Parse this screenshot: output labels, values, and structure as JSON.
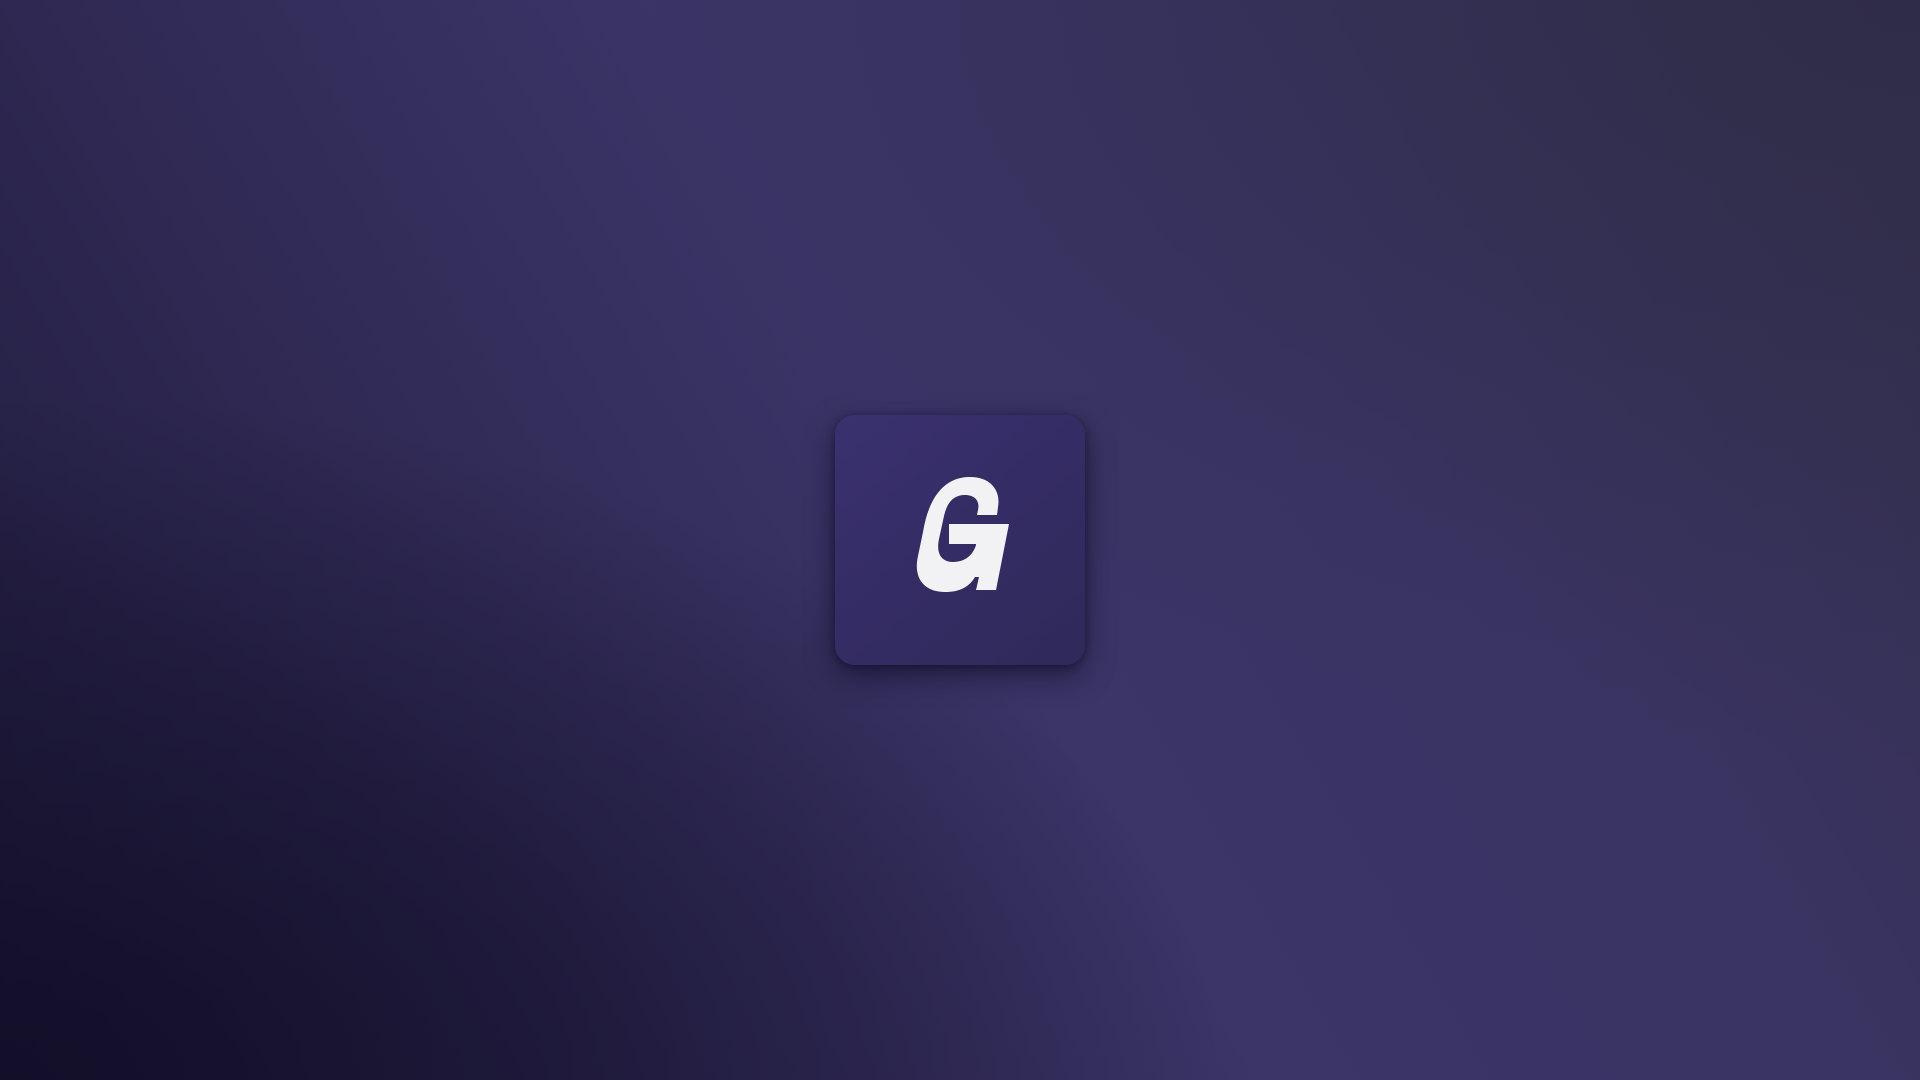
{
  "splash": {
    "logo_letter": "G",
    "icon_name": "app-logo-g-icon"
  },
  "colors": {
    "background_start": "#1e1a3a",
    "background_mid": "#3b3568",
    "background_end": "#34304f",
    "tile": "#342c64",
    "logo": "#f2f2f5"
  }
}
